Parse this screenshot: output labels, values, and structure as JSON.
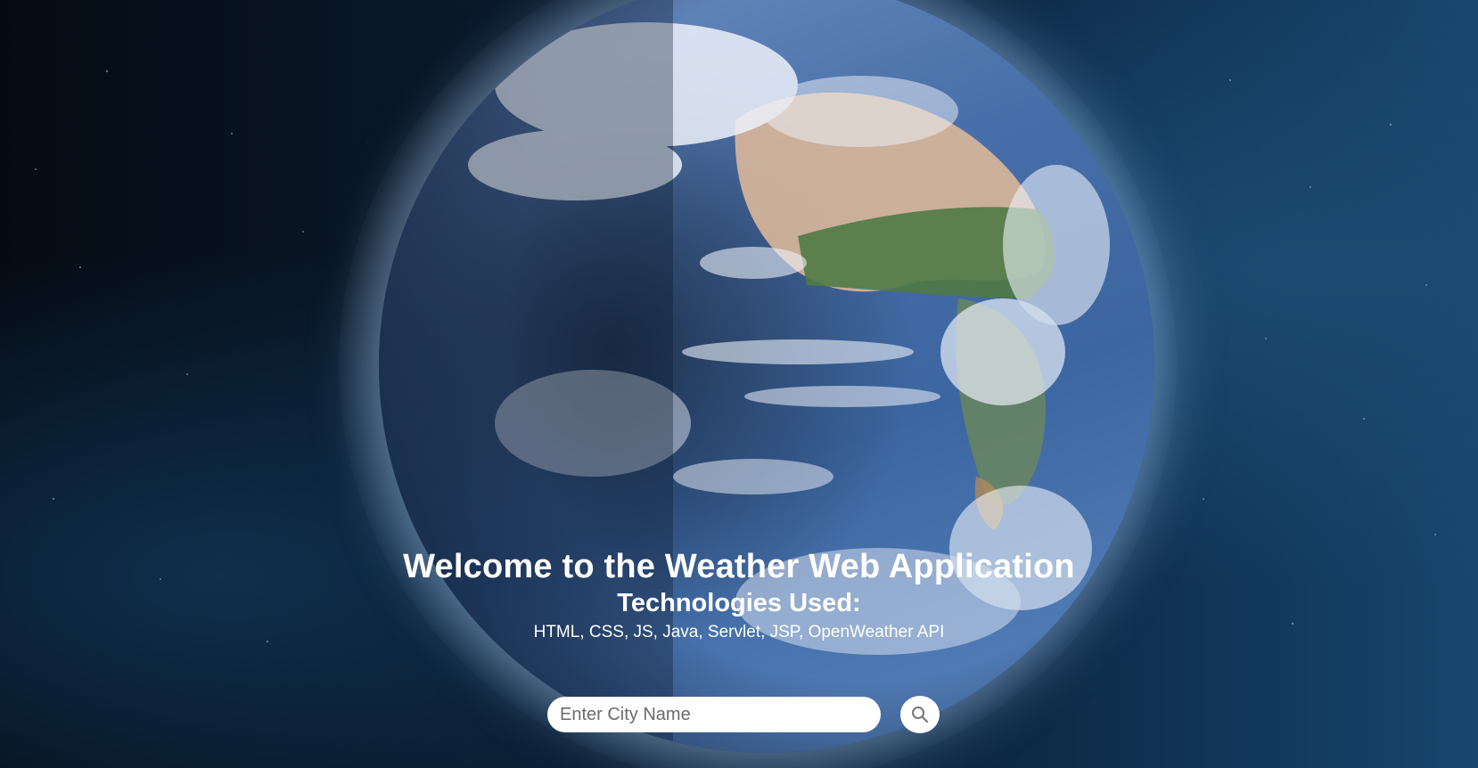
{
  "hero": {
    "title": "Welcome to the Weather Web Application",
    "subtitle": "Technologies Used:",
    "technologies": "HTML, CSS, JS, Java, Servlet, JSP, OpenWeather API"
  },
  "search": {
    "placeholder": "Enter City Name",
    "value": "",
    "button_icon": "search-icon"
  },
  "background": {
    "image": "earth-from-space",
    "space_color": "#0a1a2c",
    "ocean_color": "#476ea8"
  }
}
